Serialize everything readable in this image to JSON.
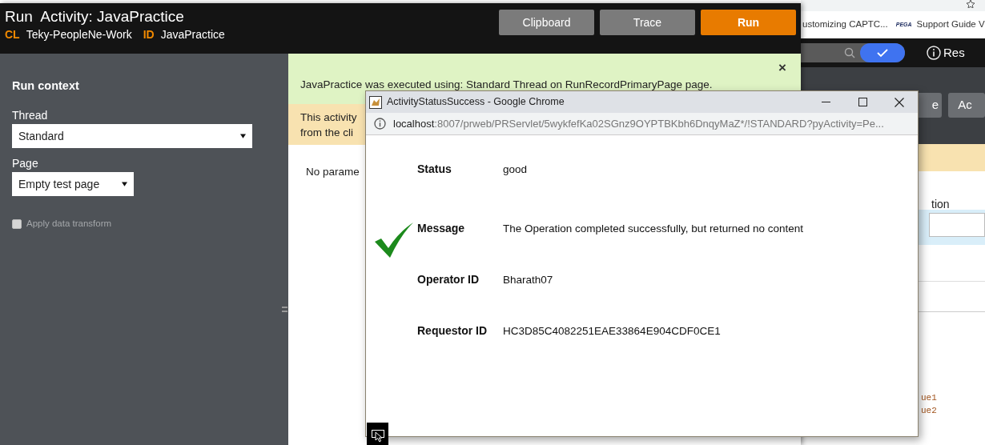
{
  "background_browser": {
    "bookmarks": [
      {
        "label": "ustomizing CAPTC..."
      },
      {
        "logo": "PEGA",
        "label": "Support Guide V"
      }
    ],
    "header_link": "Res",
    "buttons": [
      "e",
      "Ac"
    ],
    "field_label": "tion",
    "values": [
      "ue1",
      "ue2"
    ]
  },
  "run_dialog": {
    "title": "Run  Activity: JavaPractice",
    "class_tag": "CL",
    "class_value": "Teky-PeopleNe-Work",
    "id_tag": "ID",
    "id_value": "JavaPractice",
    "buttons": [
      {
        "label": "Clipboard",
        "kind": "secondary"
      },
      {
        "label": "Trace",
        "kind": "secondary"
      },
      {
        "label": "Run",
        "kind": "primary"
      }
    ],
    "sidebar": {
      "heading": "Run context",
      "fields": [
        {
          "label": "Thread",
          "value": "Standard"
        },
        {
          "label": "Page",
          "value": "Empty test page"
        }
      ],
      "checkbox": {
        "label": "Apply data transform",
        "checked": false,
        "disabled": true
      }
    },
    "success_banner": "JavaPractice was executed using: Standard Thread on RunRecordPrimaryPage page.",
    "close": "×",
    "warning_lines": [
      "This activity",
      "from the cli"
    ],
    "no_params": "No parame"
  },
  "popup": {
    "title": "ActivityStatusSuccess - Google Chrome",
    "url_host": "localhost",
    "url_rest": ":8007/prweb/PRServlet/5wykfefKa02SGnz9OYPTBKbh6DnqyMaZ*/!STANDARD?pyActivity=Pe...",
    "rows": [
      {
        "label": "Status",
        "value": "good"
      },
      {
        "label": "Message",
        "value": "The Operation completed successfully, but returned no content"
      },
      {
        "label": "Operator ID",
        "value": "Bharath07"
      },
      {
        "label": "Requestor ID",
        "value": "HC3D85C4082251EAE33864E904CDF0CE1"
      }
    ]
  }
}
